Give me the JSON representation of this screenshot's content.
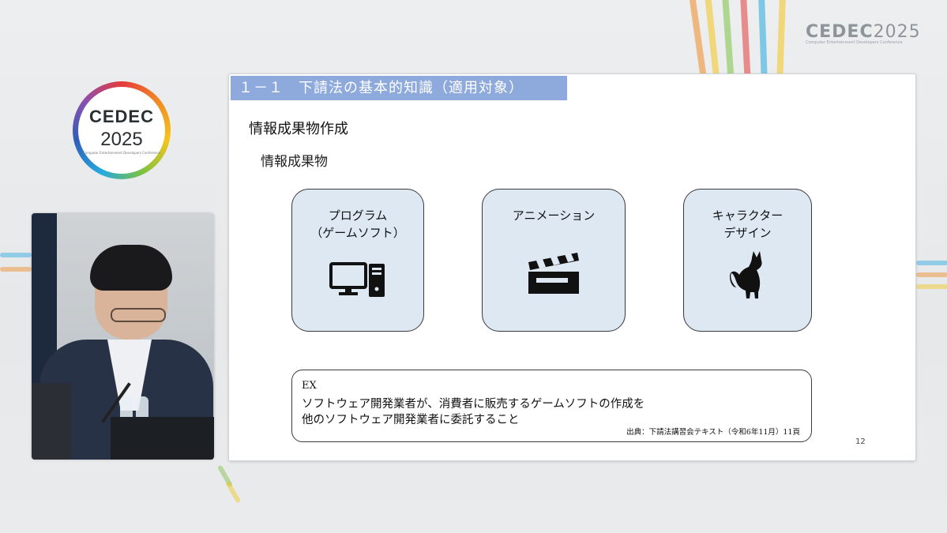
{
  "brand": {
    "name_left": "CEDEC",
    "year": "2025",
    "tagline": "Computer Entertainment Developers Conference"
  },
  "slide": {
    "title": "１－１　下請法の基本的知識（適用対象）",
    "heading": "情報成果物作成",
    "subheading": "情報成果物",
    "cards": [
      {
        "label": "プログラム\n（ゲームソフト）",
        "icon": "computer-icon"
      },
      {
        "label": "アニメーション",
        "icon": "clapperboard-icon"
      },
      {
        "label": "キャラクター\nデザイン",
        "icon": "cat-icon"
      }
    ],
    "example": {
      "tag": "EX",
      "line1": "ソフトウェア開発業者が、消費者に販売するゲームソフトの作成を",
      "line2": "他のソフトウェア開発業者に委託すること",
      "source": "出典：下請法講習会テキスト（令和6年11月）11頁"
    },
    "page_number": "12"
  },
  "colors": {
    "title_bar": "#8ea9db",
    "card_fill": "#dde8f3"
  }
}
